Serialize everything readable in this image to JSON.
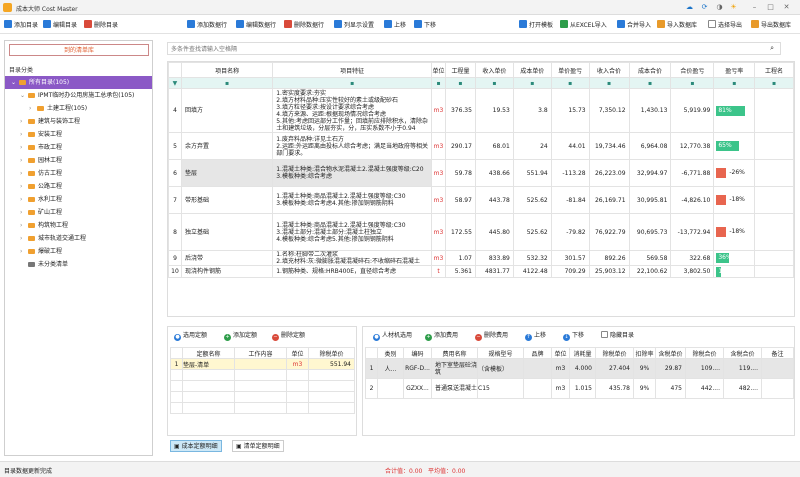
{
  "window": {
    "title": "成本大师  Cost Master"
  },
  "toolbar": {
    "add_dir": "添加目录",
    "edit_dir": "编辑目录",
    "del_dir": "删除目录",
    "add_row": "添加数据行",
    "edit_row": "编辑数据行",
    "del_row": "删除数据行",
    "columns": "列显示设置",
    "up": "上移",
    "down": "下移",
    "open_tpl": "打开模板",
    "from_excel": "从EXCEL导入",
    "merge_import": "合并导入",
    "import_lib": "导入数据库",
    "select_export": "选择导出",
    "export_lib": "导出数据库"
  },
  "left": {
    "header": "到的清单库",
    "subtitle": "目录分类",
    "tree": [
      {
        "label": "所有目录(105)",
        "level": 0,
        "arrow": "v",
        "selected": true
      },
      {
        "label": "IPMT临时办公用房施工总承包(105)",
        "level": 1,
        "arrow": "v"
      },
      {
        "label": "土建工程(105)",
        "level": 2,
        "arrow": ">"
      },
      {
        "label": "建筑与装饰工程",
        "level": 1,
        "arrow": ">"
      },
      {
        "label": "安装工程",
        "level": 1,
        "arrow": ">"
      },
      {
        "label": "市政工程",
        "level": 1,
        "arrow": ">"
      },
      {
        "label": "园林工程",
        "level": 1,
        "arrow": ">"
      },
      {
        "label": "仿古工程",
        "level": 1,
        "arrow": ">"
      },
      {
        "label": "公路工程",
        "level": 1,
        "arrow": ">"
      },
      {
        "label": "水利工程",
        "level": 1,
        "arrow": ">"
      },
      {
        "label": "矿山工程",
        "level": 1,
        "arrow": ">"
      },
      {
        "label": "构筑物工程",
        "level": 1,
        "arrow": ">"
      },
      {
        "label": "城市轨道交通工程",
        "level": 1,
        "arrow": ">"
      },
      {
        "label": "爆破工程",
        "level": 1,
        "arrow": ">"
      },
      {
        "label": "未分类清单",
        "level": 1,
        "arrow": ""
      }
    ]
  },
  "search": {
    "placeholder": "多条件查找请输入空格隔"
  },
  "grid": {
    "headers": [
      "",
      "项目名称",
      "项目特征",
      "单位",
      "工程量",
      "收入单价",
      "成本单价",
      "单价盈亏",
      "收入合价",
      "成本合价",
      "合价盈亏",
      "盈亏率",
      "工程名"
    ],
    "filter_icon": "▼",
    "rows": [
      {
        "no": "4",
        "name": "回填方",
        "feature": "1.密实度要求:夯实\n2.填方材料品种:压实性较好的素土或级配砂石\n3.填方粒径要求:按设计要求综合考虑\n4.填方来源、运距:根据现场情况综合考虑\n5.其他:考虑回运部分工作量；回填前应排除积水，清除杂土和建筑垃圾，分层夯实，分，压实系数不小于0.94",
        "unit": "m3",
        "qty": "376.35",
        "inprice": "19.53",
        "costprice": "3.8",
        "pdiff": "15.73",
        "intotal": "7,350.12",
        "costtotal": "1,430.13",
        "tdiff": "5,919.99",
        "rate": "81%",
        "pct": 81,
        "neg": false
      },
      {
        "no": "5",
        "name": "余方弃置",
        "feature": "1.废弃料品种:详见土石方\n2.运距:外运距离由投标人综合考虑；满足当地政府等相关部门要求。",
        "unit": "m3",
        "qty": "290.17",
        "inprice": "68.01",
        "costprice": "24",
        "pdiff": "44.01",
        "intotal": "19,734.46",
        "costtotal": "6,964.08",
        "tdiff": "12,770.38",
        "rate": "65%",
        "pct": 65,
        "neg": false
      },
      {
        "no": "6",
        "name": "垫层",
        "feature": "1.混凝土种类:混合物水泥混凝土2.混凝土强度等级:C20\n3.模板种类:综合考虑",
        "unit": "m3",
        "qty": "59.78",
        "inprice": "438.66",
        "costprice": "551.94",
        "pdiff": "-113.28",
        "intotal": "26,223.09",
        "costtotal": "32,994.97",
        "tdiff": "-6,771.88",
        "rate": "-26%",
        "pct": 26,
        "neg": true
      },
      {
        "no": "7",
        "name": "带形基础",
        "feature": "1.混凝土种类:商品混凝土2.混凝土强度等级:C30\n3.模板种类:综合考虑4.其他:掺加铜钢筋阴料",
        "unit": "m3",
        "qty": "58.97",
        "inprice": "443.78",
        "costprice": "525.62",
        "pdiff": "-81.84",
        "intotal": "26,169.71",
        "costtotal": "30,995.81",
        "tdiff": "-4,826.10",
        "rate": "-18%",
        "pct": 18,
        "neg": true
      },
      {
        "no": "8",
        "name": "独立基础",
        "feature": "1.混凝土种类:商品混凝土2.混凝土强度等级:C30\n3.混凝土部分:混凝土部分:混凝土柱独立\n4.模板种类:综合考虑5.其他:掺加铜钢筋阴料",
        "unit": "m3",
        "qty": "172.55",
        "inprice": "445.80",
        "costprice": "525.62",
        "pdiff": "-79.82",
        "intotal": "76,922.79",
        "costtotal": "90,695.73",
        "tdiff": "-13,772.94",
        "rate": "-18%",
        "pct": 18,
        "neg": true
      },
      {
        "no": "9",
        "name": "后浇带",
        "feature": "1.名称:柱脚带二次灌浆\n2.填充材料:灰:微膨胀混凝混凝碎石:不收缩碎石混凝土",
        "unit": "m3",
        "qty": "1.07",
        "inprice": "833.89",
        "costprice": "532.32",
        "pdiff": "301.57",
        "intotal": "892.26",
        "costtotal": "569.58",
        "tdiff": "322.68",
        "rate": "36%",
        "pct": 36,
        "neg": false
      },
      {
        "no": "10",
        "name": "现浇构件钢筋",
        "feature": "1.钢筋种类、规格:HRB400E，直径综合考虑",
        "unit": "t",
        "qty": "5.361",
        "inprice": "4831.77",
        "costprice": "4122.48",
        "pdiff": "709.29",
        "intotal": "25,903.12",
        "costtotal": "22,100.62",
        "tdiff": "3,802.50",
        "rate": "15%",
        "pct": 15,
        "neg": false
      }
    ]
  },
  "quota": {
    "btn_select": "选用定额",
    "btn_add": "添加定额",
    "btn_del": "删除定额",
    "headers": [
      "",
      "定额名称",
      "工作内容",
      "单位",
      "除税单价"
    ],
    "rows": [
      {
        "no": "1",
        "name": "垫层-清单",
        "work": "",
        "unit": "m3",
        "price": "551.94"
      }
    ]
  },
  "material": {
    "btn_select": "人材机选用",
    "btn_add": "添加费用",
    "btn_del": "删除费用",
    "btn_up": "上移",
    "btn_down": "下移",
    "hide_dir": "隐藏目录",
    "headers": [
      "",
      "类别",
      "编码",
      "费用名称",
      "规格型号",
      "品牌",
      "单位",
      "消耗量",
      "除税单价",
      "扣除率",
      "含税单价",
      "除税合价",
      "含税合价",
      "备注"
    ],
    "rows": [
      {
        "no": "1",
        "cat": "人...",
        "code": "RGF-D...",
        "name": "地下室垫层砼浇筑",
        "spec": "（含模板）",
        "brand": "",
        "unit": "m3",
        "qty": "4.000",
        "nprice": "27.404",
        "rate": "9%",
        "tprice": "29.87",
        "ntotal": "109....",
        "ttotal": "119....",
        "note": ""
      },
      {
        "no": "2",
        "cat": "",
        "code": "GZXX...",
        "name": "普通泵送混凝土",
        "spec": "C15",
        "brand": "",
        "unit": "m3",
        "qty": "1.015",
        "nprice": "435.78",
        "rate": "9%",
        "tprice": "475",
        "ntotal": "442....",
        "ttotal": "482....",
        "note": ""
      }
    ]
  },
  "tabs": {
    "t1": "成本定额明细",
    "t2": "清单定额明细"
  },
  "status": {
    "left": "目录数据更新完成",
    "total": "合计值：0.00",
    "avg": "平均值：0.00"
  },
  "colors": {
    "accent": "#8b59c6",
    "green": "#3cc48a",
    "red": "#e8654f",
    "link": "#1a73c8"
  }
}
